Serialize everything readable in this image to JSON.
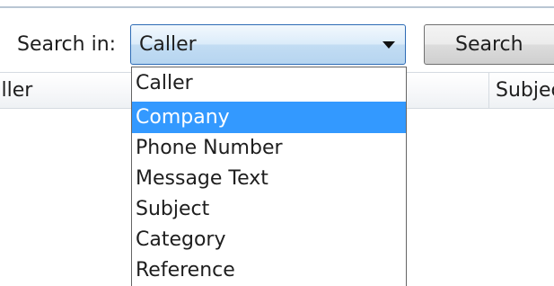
{
  "search": {
    "label": "Search in:",
    "selected_value": "Caller",
    "button_label": "Search"
  },
  "grid": {
    "columns": [
      "aller",
      "Subjec"
    ]
  },
  "dropdown": {
    "options": [
      "Caller",
      "Company",
      "Phone Number",
      "Message Text",
      "Subject",
      "Category",
      "Reference"
    ],
    "highlighted": "Company"
  },
  "colors": {
    "highlight": "#3399ff",
    "combo_border": "#2d6bb5"
  },
  "icons": {
    "combo_arrow": "chevron-down-icon"
  }
}
